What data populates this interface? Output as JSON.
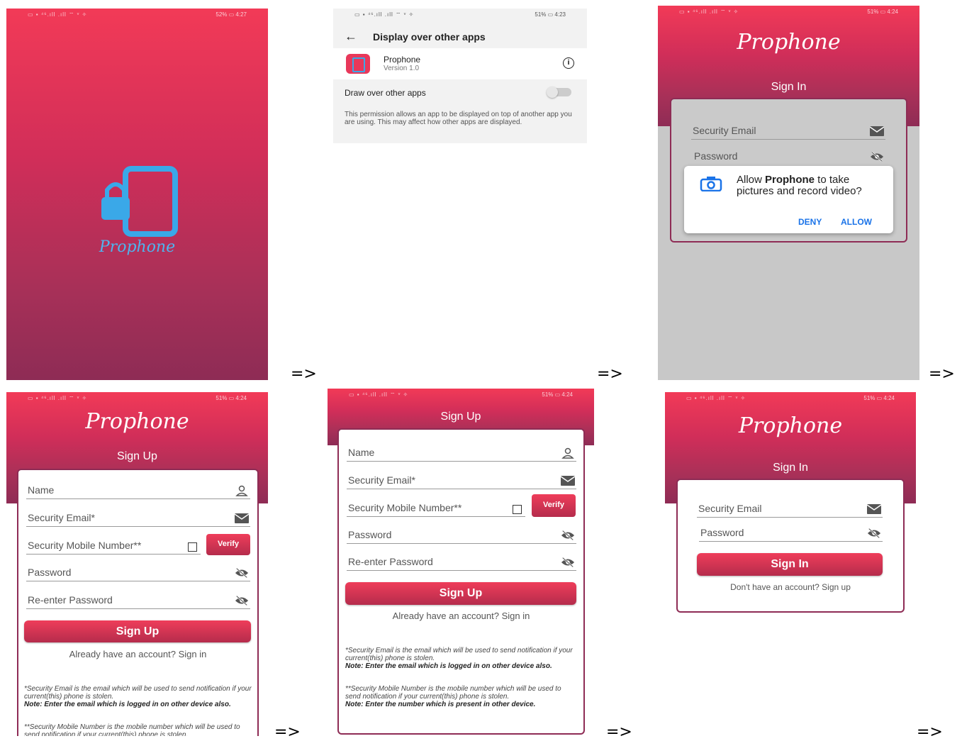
{
  "arrow": "=>",
  "status": {
    "s1_time": "52% ▭ 4:27",
    "s2_time": "51% ▭ 4:23",
    "s3_time": "51% ▭ 4:24",
    "icons": "▭ ▪ ⁴⁶.ıll .ıll ⌔ ᵛ ✧"
  },
  "splash": {
    "app_name": "Prophone"
  },
  "settings": {
    "title": "Display over other apps",
    "app_name": "Prophone",
    "app_version": "Version 1.0",
    "toggle_label": "Draw over other apps",
    "description": "This permission allows an app to be displayed on top of another app you are using. This may affect how other apps are displayed."
  },
  "permission_screen": {
    "logo": "Prophone",
    "heading": "Sign In",
    "email_label": "Security Email",
    "password_label": "Password",
    "dialog": {
      "text_pre": "Allow ",
      "text_bold": "Prophone",
      "text_post": " to take pictures and record video?",
      "deny": "DENY",
      "allow": "ALLOW"
    }
  },
  "signup": {
    "logo": "Prophone",
    "heading": "Sign Up",
    "name_label": "Name",
    "email_label": "Security Email*",
    "mobile_label": "Security Mobile Number**",
    "verify": "Verify",
    "password_label": "Password",
    "reenter_label": "Re-enter Password",
    "button": "Sign Up",
    "signin_link": "Already have an account? Sign in",
    "note1": "*Security Email is the email which will be used to send notification if your current(this) phone is stolen.",
    "note1_bold": "Note: Enter the email which is logged in on other device also.",
    "note2": "**Security Mobile Number is the mobile number which will be used to send notification if your current(this) phone is stolen.",
    "note2_bold": "Note: Enter the number which is present in other device."
  },
  "signin": {
    "logo": "Prophone",
    "heading": "Sign In",
    "email_label": "Security Email",
    "password_label": "Password",
    "button": "Sign In",
    "signup_link": "Don't have an account? Sign up"
  },
  "colors": {
    "brand_top": "#f23a57",
    "brand_bottom": "#8e2c55",
    "accent_blue": "#1a73e8",
    "lock_blue": "#3aa8e8"
  }
}
